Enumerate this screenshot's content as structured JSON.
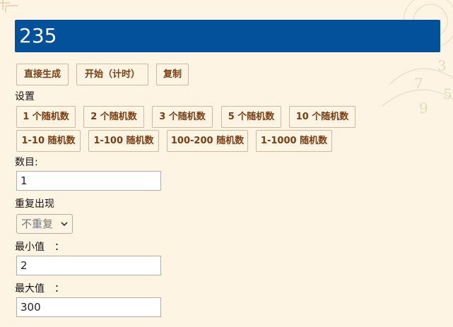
{
  "result": {
    "value": "235"
  },
  "actions": {
    "generate_label": "直接生成",
    "start_label": "开始（计时）",
    "copy_label": "复制"
  },
  "settings": {
    "title": "设置",
    "presets_row1": [
      "1 个随机数",
      "2 个随机数",
      "3 个随机数",
      "5 个随机数",
      "10 个随机数"
    ],
    "presets_row2": [
      "1-10 随机数",
      "1-100 随机数",
      "100-200 随机数",
      "1-1000 随机数"
    ]
  },
  "form": {
    "count_label": "数目:",
    "count_value": "1",
    "repeat_label": "重复出现",
    "repeat_value": "不重复",
    "min_label": "最小值　：",
    "min_value": "2",
    "max_label": "最大值　：",
    "max_value": "300"
  },
  "colors": {
    "background": "#fdf4e3",
    "result_bg": "#03519a",
    "button_text": "#7a3d12"
  }
}
